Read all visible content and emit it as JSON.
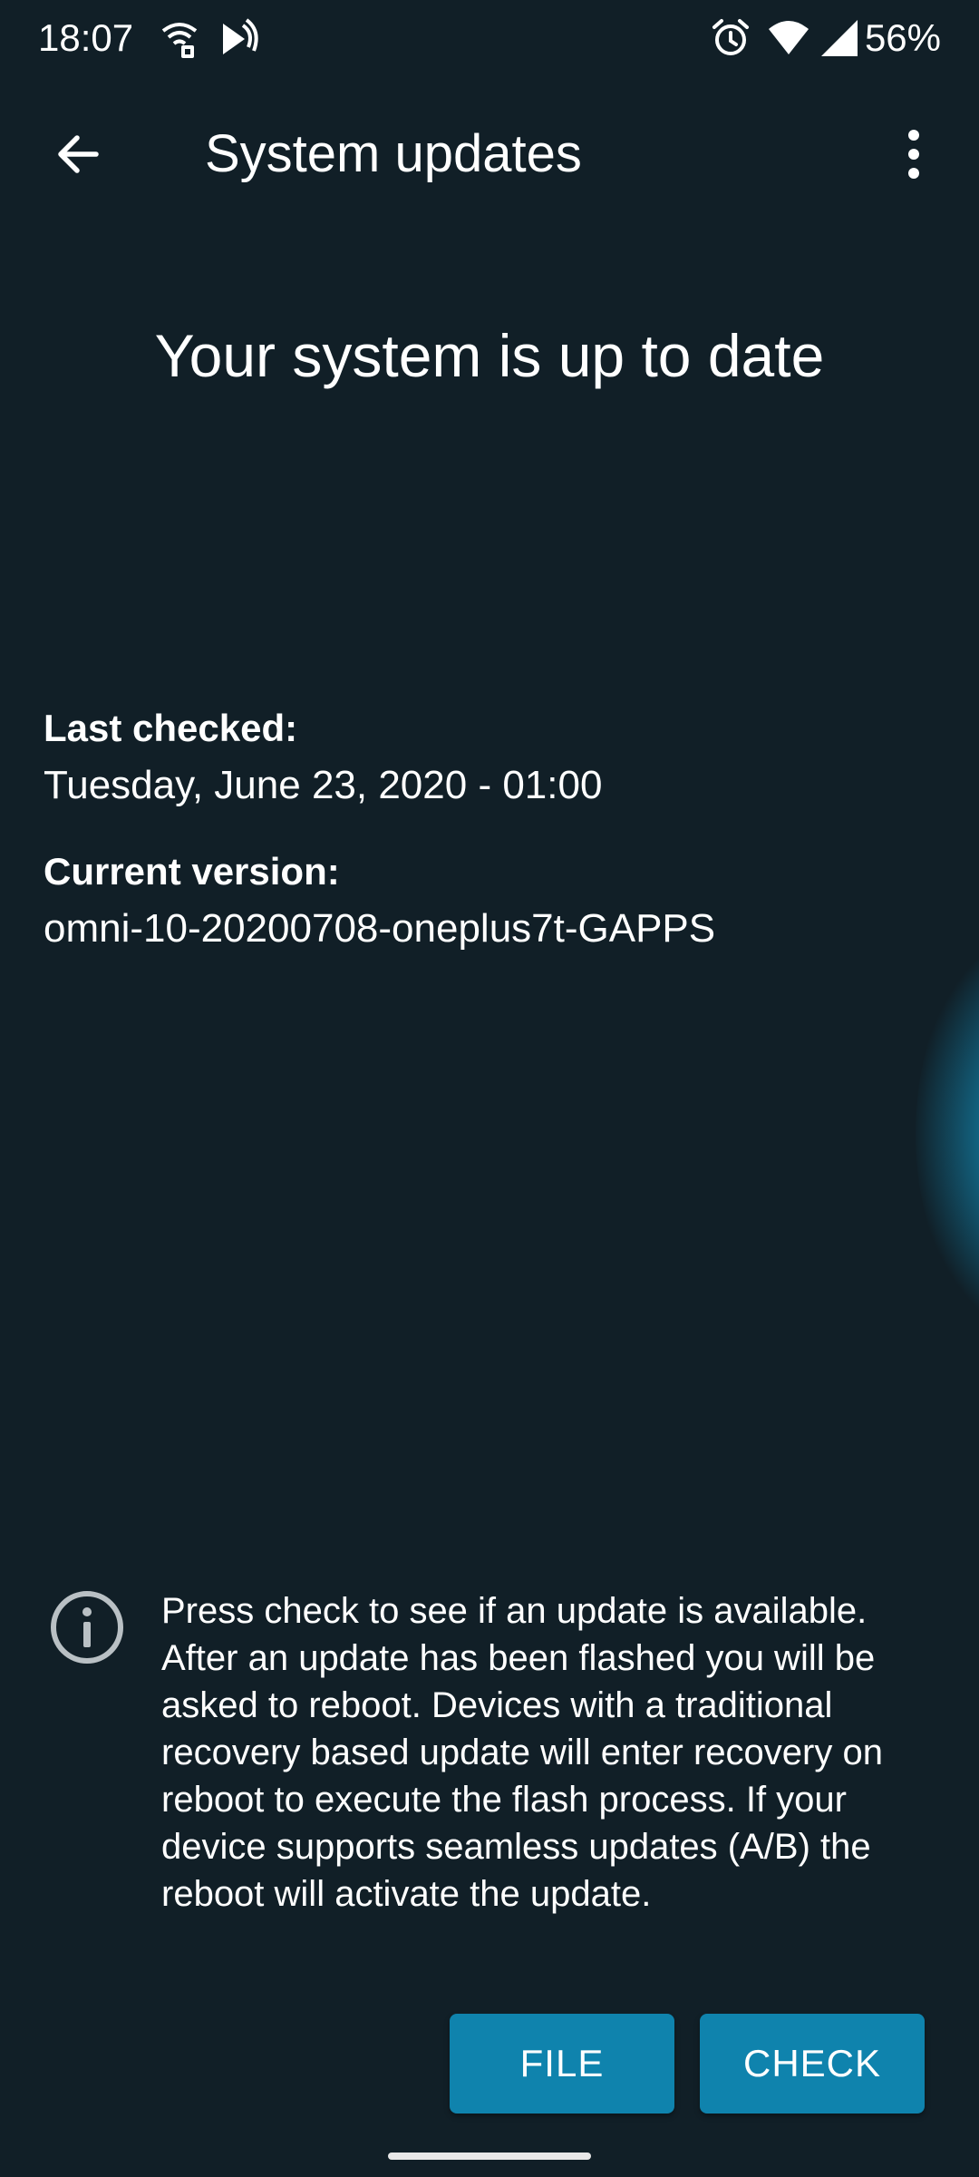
{
  "status_bar": {
    "time": "18:07",
    "battery": "56%",
    "icons": [
      "wifi-calling-icon",
      "cast-icon",
      "alarm-icon",
      "wifi-icon",
      "cell-signal-icon"
    ]
  },
  "app_bar": {
    "title": "System updates",
    "back_icon": "arrow-back-icon",
    "more_icon": "more-vert-icon"
  },
  "main": {
    "headline": "Your system is up to date",
    "last_checked_label": "Last checked:",
    "last_checked_value": "Tuesday, June 23, 2020 - 01:00",
    "current_version_label": "Current version:",
    "current_version_value": "omni-10-20200708-oneplus7t-GAPPS"
  },
  "note": {
    "icon": "info-icon",
    "text": "Press check to see if an update is available. After an update has been flashed you will be asked to reboot. Devices with a traditional recovery based update will enter recovery on reboot to execute the flash process. If your device supports seamless updates (A/B) the reboot will activate the update."
  },
  "buttons": {
    "file_label": "FILE",
    "check_label": "CHECK"
  },
  "colors": {
    "background": "#111f27",
    "accent": "#0f83ad",
    "text": "#ffffff"
  }
}
